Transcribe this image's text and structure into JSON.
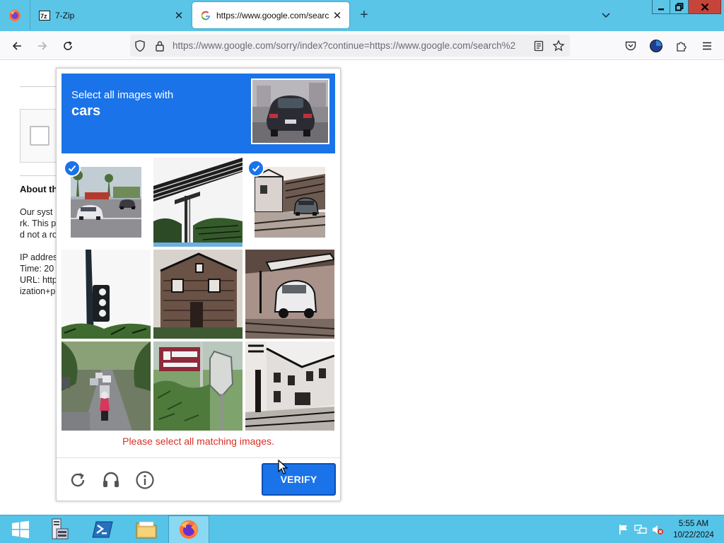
{
  "browser": {
    "tabs": [
      {
        "title": "7-Zip",
        "favicon": "7zip-icon",
        "active": false
      },
      {
        "title": "https://www.google.com/search",
        "favicon": "google-icon",
        "active": true
      }
    ],
    "new_tab_symbol": "+",
    "close_symbol": "✕",
    "address": "https://www.google.com/sorry/index?continue=https://www.google.com/search%2"
  },
  "page": {
    "about_heading": "About th",
    "lines": [
      "Our syst",
      "rk. This p",
      "d not a ro",
      "IP addres",
      "Time: 20",
      "URL: http",
      "ization+p"
    ]
  },
  "captcha": {
    "instruction": "Select all images with",
    "target": "cars",
    "tiles": [
      {
        "subject": "street-with-cars",
        "selected": true
      },
      {
        "subject": "overpass-bridge",
        "selected": false
      },
      {
        "subject": "house-with-car",
        "selected": true
      },
      {
        "subject": "traffic-light",
        "selected": false
      },
      {
        "subject": "brick-house",
        "selected": false
      },
      {
        "subject": "car-under-carport",
        "selected": false
      },
      {
        "subject": "road-with-scooter",
        "selected": false
      },
      {
        "subject": "street-sign",
        "selected": false
      },
      {
        "subject": "townhouses",
        "selected": false
      }
    ],
    "error": "Please select all matching images.",
    "verify_label": "VERIFY"
  },
  "taskbar": {
    "time": "5:55 AM",
    "date": "10/22/2024"
  },
  "colors": {
    "accent": "#1a73e8",
    "error": "#d93025",
    "titlebar": "#5bc5e8",
    "close": "#c7443a"
  }
}
